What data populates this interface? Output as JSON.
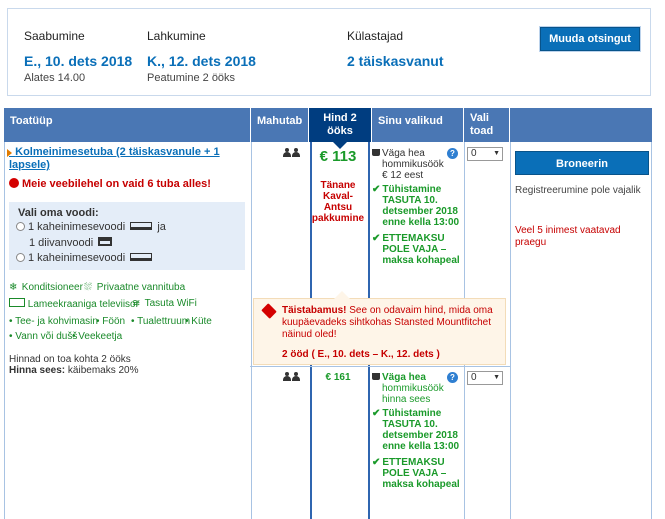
{
  "summary": {
    "checkin_label": "Saabumine",
    "checkin_value": "E., 10. dets 2018",
    "checkin_sub": "Alates 14.00",
    "checkout_label": "Lahkumine",
    "checkout_value": "K., 12. dets 2018",
    "checkout_sub": "Peatumine 2 ööks",
    "guests_label": "Külastajad",
    "guests_value": "2 täiskasvanut",
    "change_button": "Muuda otsingut"
  },
  "table_headers": {
    "room_type": "Toatüüp",
    "sleeps": "Mahutab",
    "price_line1": "Hind 2",
    "price_line2": "ööks",
    "choices": "Sinu valikud",
    "select_line1": "Vali",
    "select_line2": "toad"
  },
  "room": {
    "name": "Kolmeinimesetuba (2 täiskasvanule + 1 lapsele)",
    "scarcity": "Meie veebilehel on vaid 6 tuba alles!",
    "bed_heading": "Vali oma voodi:",
    "bed_option1_a": "1 kaheinimesevoodi",
    "bed_option1_b": "ja",
    "bed_option1_c": "1 diivanvoodi",
    "bed_option2": "1 kaheinimesevoodi",
    "amenities": {
      "a1": "Konditsioneer",
      "a2": "Privaatne vannituba",
      "a3": "Lameekraaniga televiisor",
      "a4": "Tasuta WiFi",
      "b1": "• Tee- ja kohvimasin",
      "b2": "• Föön",
      "b3": "• Tualettruum",
      "b4": "• Küte",
      "b5": "• Vann või dušš",
      "b6": "• Veekeetja"
    },
    "price_note": "Hinnad on toa kohta 2 ööks",
    "includes_label": "Hinna sees:",
    "includes_value": "käibemaks 20%"
  },
  "offer1": {
    "price": "€ 113",
    "deal": "Tänane Kaval-Antsu pakkumine",
    "breakfast_line1": "Väga hea",
    "breakfast_line2": "hommikusöök",
    "breakfast_extra": "€ 12 eest",
    "cancel": "Tühistamine TASUTA 10. detsember 2018 enne kella 13:00",
    "prepay": "ETTEMAKSU POLE VAJA – maksa kohapeal",
    "qty": "0"
  },
  "offer2": {
    "price": "€ 161",
    "breakfast_line1": "Väga hea",
    "breakfast_line2": "hommikusöök",
    "breakfast_extra": "hinna sees",
    "cancel": "Tühistamine TASUTA 10. detsember 2018 enne kella 13:00",
    "prepay": "ETTEMAKSU POLE VAJA – maksa kohapeal",
    "qty": "0"
  },
  "booking": {
    "book_button": "Broneerin",
    "no_registration": "Registreerumine pole vajalik",
    "watching": "Veel 5 inimest vaatavad praegu"
  },
  "tip": {
    "bold": "Täistabamus!",
    "text": "See on odavaim hind, mida oma kuupäevadeks sihtkohas Stansted Mountfitchet näinud oled!",
    "dates": "2 ööd ( E., 10. dets – K., 12. dets )"
  },
  "colors": {
    "accent": "#0a6fb8",
    "header": "#4a77b4",
    "header_active": "#003d80",
    "green": "#1a9a2a",
    "red": "#c60000"
  }
}
